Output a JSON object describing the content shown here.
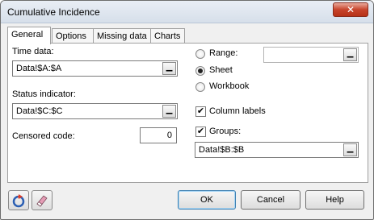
{
  "window": {
    "title": "Cumulative Incidence",
    "close_glyph": "✕"
  },
  "tabs": [
    {
      "label": "General",
      "active": true
    },
    {
      "label": "Options",
      "active": false
    },
    {
      "label": "Missing data",
      "active": false
    },
    {
      "label": "Charts",
      "active": false
    }
  ],
  "general": {
    "time_data": {
      "label": "Time data:",
      "value": "Data!$A:$A"
    },
    "status_indicator": {
      "label": "Status indicator:",
      "value": "Data!$C:$C"
    },
    "censored_code": {
      "label": "Censored code:",
      "value": "0"
    },
    "range_option": {
      "label": "Range:",
      "checked": false,
      "value": ""
    },
    "sheet_option": {
      "label": "Sheet",
      "checked": true
    },
    "workbook_option": {
      "label": "Workbook",
      "checked": false
    },
    "column_labels": {
      "label": "Column labels",
      "checked": true,
      "mark": "✔"
    },
    "groups": {
      "label": "Groups:",
      "checked": true,
      "mark": "✔",
      "value": "Data!$B:$B"
    },
    "ref_button_glyph": "▁"
  },
  "buttons": {
    "ok": "OK",
    "cancel": "Cancel",
    "help": "Help"
  },
  "icons": {
    "reset": "reset-icon",
    "eraser": "eraser-icon"
  },
  "colors": {
    "reset_red": "#d83a2a",
    "reset_blue": "#2c5fb3",
    "eraser_pink": "#e59cb5"
  }
}
